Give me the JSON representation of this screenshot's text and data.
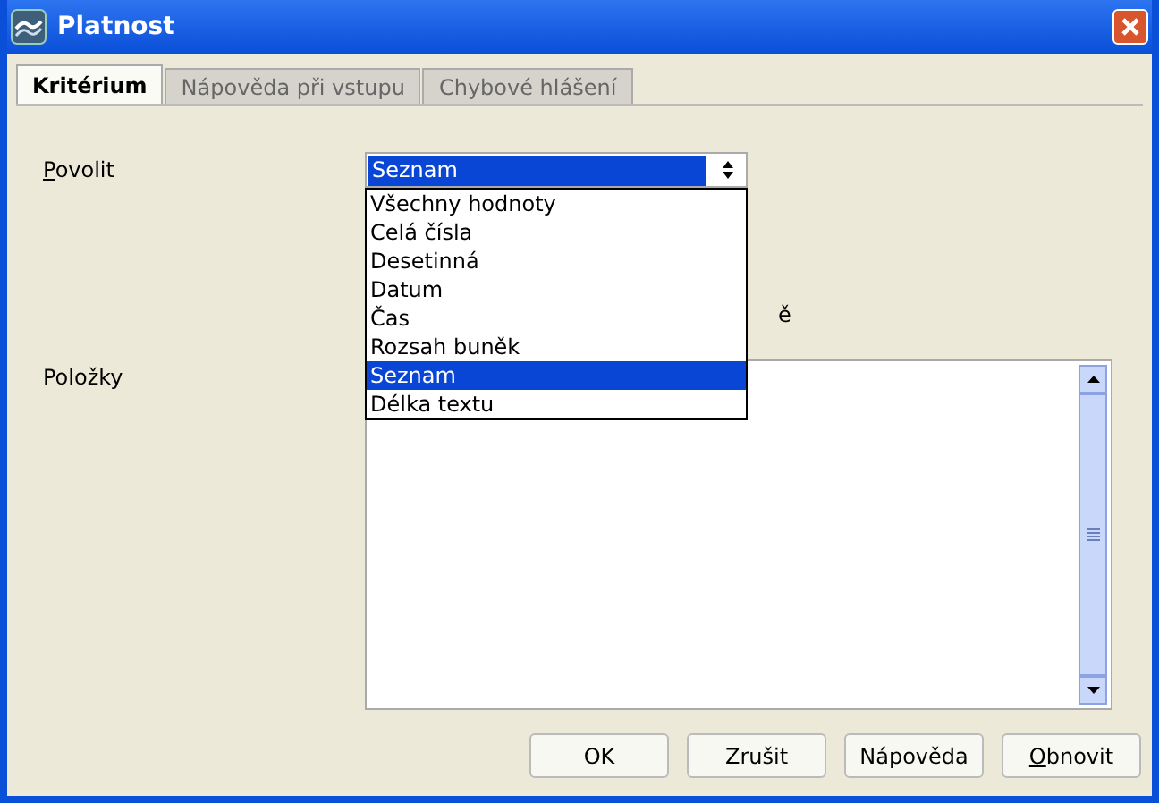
{
  "window": {
    "title": "Platnost"
  },
  "tabs": [
    {
      "label": "Kritérium",
      "selected": true
    },
    {
      "label": "Nápověda při vstupu",
      "selected": false
    },
    {
      "label": "Chybové hlášení",
      "selected": false
    }
  ],
  "allow": {
    "label": "Povolit",
    "underline_first": true,
    "value": "Seznam",
    "expanded": true,
    "options": [
      {
        "label": "Všechny hodnoty",
        "selected": false
      },
      {
        "label": "Celá čísla",
        "selected": false
      },
      {
        "label": "Desetinná",
        "selected": false
      },
      {
        "label": "Datum",
        "selected": false
      },
      {
        "label": "Čas",
        "selected": false
      },
      {
        "label": "Rozsah buněk",
        "selected": false
      },
      {
        "label": "Seznam",
        "selected": true
      },
      {
        "label": "Délka textu",
        "selected": false
      }
    ]
  },
  "hidden_label_tail": "ě",
  "items": {
    "label": "Položky"
  },
  "buttons": [
    {
      "label": "OK",
      "underline_first": false
    },
    {
      "label": "Zrušit",
      "underline_first": false
    },
    {
      "label": "Nápověda",
      "underline_first": false
    },
    {
      "label": "Obnovit",
      "underline_first": true
    }
  ]
}
